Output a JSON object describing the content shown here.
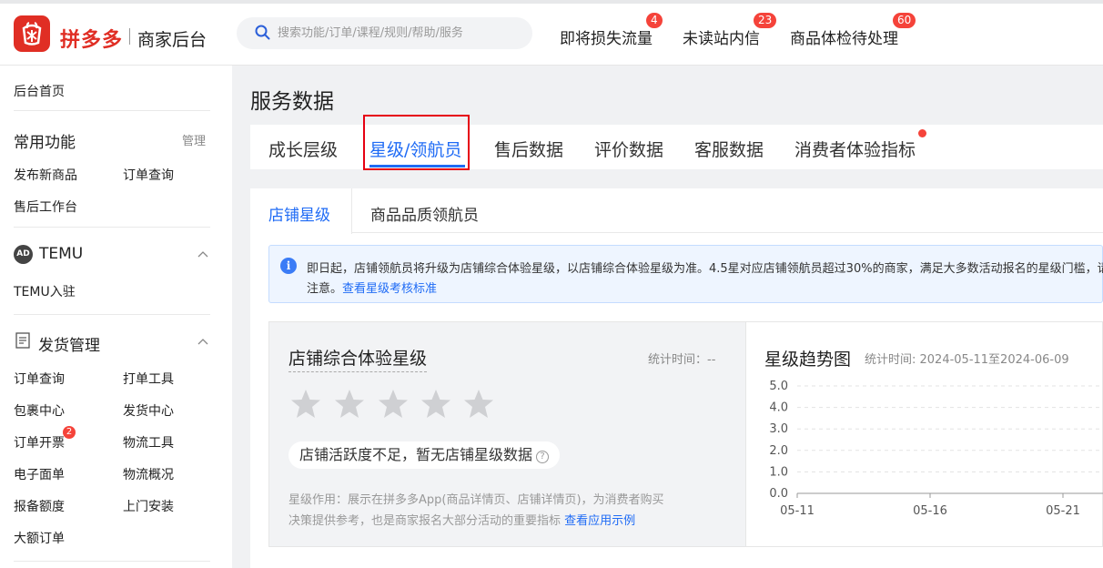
{
  "header": {
    "brand": "拼多多",
    "subtitle": "商家后台",
    "search_placeholder": "搜索功能/订单/课程/规则/帮助/服务",
    "links": [
      {
        "label": "即将损失流量",
        "badge": "4"
      },
      {
        "label": "未读站内信",
        "badge": "23"
      },
      {
        "label": "商品体检待处理",
        "badge": "60"
      }
    ]
  },
  "sidebar": {
    "home": "后台首页",
    "common": {
      "title": "常用功能",
      "manage": "管理",
      "items": [
        "发布新商品",
        "订单查询",
        "售后工作台"
      ]
    },
    "temu": {
      "icon_text": "AD",
      "title": "TEMU",
      "items": [
        "TEMU入驻"
      ]
    },
    "shipping": {
      "title": "发货管理",
      "items": [
        "订单查询",
        "打单工具",
        "包裹中心",
        "发货中心",
        "订单开票",
        "物流工具",
        "电子面单",
        "物流概况",
        "报备额度",
        "上门安装",
        "大额订单"
      ],
      "invoice_badge": "2"
    }
  },
  "main": {
    "title": "服务数据",
    "tabs": [
      "成长层级",
      "星级/领航员",
      "售后数据",
      "评价数据",
      "客服数据",
      "消费者体验指标"
    ],
    "active_tab": 1,
    "subtabs": [
      "店铺星级",
      "商品品质领航员"
    ],
    "notice": {
      "line1": "即日起，店铺领航员将升级为店铺综合体验星级，以店铺综合体验星级为准。4.5星对应店铺领航员超过30%的商家，满足大多数活动报名的星级门槛，请商家",
      "line2_prefix": "注意。",
      "line2_link": "查看星级考核标准"
    },
    "star_panel": {
      "title": "店铺综合体验星级",
      "time": "统计时间：--",
      "stars": 5,
      "status": "店铺活跃度不足，暂无店铺星级数据",
      "desc_line1": "星级作用：展示在拼多多App(商品详情页、店铺详情页)，为消费者购买",
      "desc_line2": "决策提供参考，也是商家报名大部分活动的重要指标",
      "desc_link": "查看应用示例"
    },
    "trend_panel": {
      "title": "星级趋势图",
      "time": "统计时间: 2024-05-11至2024-06-09"
    }
  },
  "colors": {
    "brand": "#e02e24",
    "accent": "#1f6bf5",
    "badge": "#f5433a"
  },
  "chart_data": {
    "type": "line",
    "title": "",
    "yticks": [
      "5.0",
      "4.0",
      "3.0",
      "2.0",
      "1.0",
      "0.0"
    ],
    "xticks": [
      "05-11",
      "05-16",
      "05-21"
    ],
    "ylim": [
      0,
      5
    ],
    "grid": true,
    "series": []
  }
}
